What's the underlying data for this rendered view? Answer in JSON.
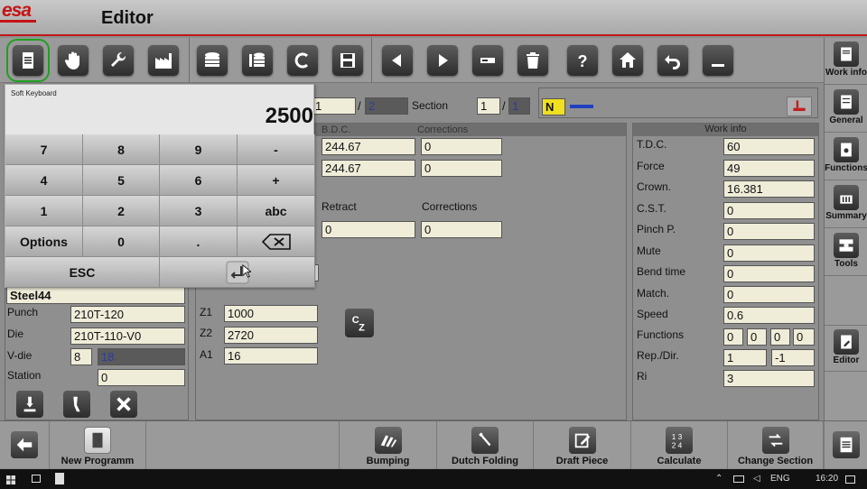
{
  "app": {
    "logo": "esa",
    "title": "Editor"
  },
  "toolbar": {
    "buttons": [
      "document-icon",
      "hand-icon",
      "wrench-icon",
      "factory-icon",
      "database-icon",
      "database-edit-icon",
      "c-icon",
      "save-icon",
      "arrow-left-icon",
      "arrow-right-icon",
      "minus-icon",
      "trash-icon",
      "help-icon",
      "home-icon",
      "undo-icon",
      "minimize-icon"
    ]
  },
  "right_panel": {
    "items": [
      {
        "label": "Work info",
        "icon": "work-info-icon"
      },
      {
        "label": "General",
        "icon": "general-icon"
      },
      {
        "label": "Functions",
        "icon": "functions-icon"
      },
      {
        "label": "Summary",
        "icon": "summary-icon"
      },
      {
        "label": "Tools",
        "icon": "tools-icon"
      },
      {
        "label": "Editor",
        "icon": "editor-icon"
      }
    ]
  },
  "status": {
    "bend_current": "1",
    "bend_total": "2",
    "section_label": "Section",
    "section_current": "1",
    "section_total": "1",
    "mode": "N"
  },
  "bend_panel": {
    "bdc_label": "B.D.C.",
    "corrections_label": "Corrections",
    "bdc_values": [
      "244.67",
      "244.67"
    ],
    "corrections_values": [
      "0",
      "0"
    ],
    "retract_label": "Retract",
    "retract_corrections_label": "Corrections",
    "retract_value": "0",
    "retract_correction_value": "0",
    "z1_label": "Z1",
    "z1": "1000",
    "z2_label": "Z2",
    "z2": "2720",
    "a1_label": "A1",
    "a1": "16"
  },
  "tool_panel": {
    "material": "Steel44",
    "punch_label": "Punch",
    "punch": "210T-120",
    "die_label": "Die",
    "die": "210T-110-V0",
    "vdie_label": "V-die",
    "vdie_a": "8",
    "vdie_b": "18",
    "station_label": "Station",
    "station": "0"
  },
  "work_info": {
    "header": "Work info",
    "rows": [
      {
        "label": "T.D.C.",
        "value": "60"
      },
      {
        "label": "Force",
        "value": "49"
      },
      {
        "label": "Crown.",
        "value": "16.381"
      },
      {
        "label": "C.S.T.",
        "value": "0"
      },
      {
        "label": "Pinch P.",
        "value": "0"
      },
      {
        "label": "Mute",
        "value": "0"
      },
      {
        "label": "Bend time",
        "value": "0"
      },
      {
        "label": "Match.",
        "value": "0"
      },
      {
        "label": "Speed",
        "value": "0.6"
      }
    ],
    "functions_label": "Functions",
    "functions": [
      "0",
      "0",
      "0",
      "0"
    ],
    "repdir_label": "Rep./Dir.",
    "rep": "1",
    "dir": "-1",
    "ri_label": "Ri",
    "ri": "3"
  },
  "keyboard": {
    "title": "Soft Keyboard",
    "value": "2500",
    "keys": [
      [
        "7",
        "8",
        "9",
        "-"
      ],
      [
        "4",
        "5",
        "6",
        "+"
      ],
      [
        "1",
        "2",
        "3",
        "abc"
      ],
      [
        "Options",
        "0",
        ".",
        "⌫"
      ]
    ],
    "esc": "ESC"
  },
  "bottombar": {
    "items": [
      {
        "label": "",
        "icon": "back-arrow-icon"
      },
      {
        "label": "New Programm",
        "icon": "new-document-icon"
      },
      {
        "label": "Bumping",
        "icon": "bumping-icon"
      },
      {
        "label": "Dutch Folding",
        "icon": "dutch-folding-icon"
      },
      {
        "label": "Draft Piece",
        "icon": "draft-piece-icon"
      },
      {
        "label": "Calculate",
        "icon": "calculate-icon"
      },
      {
        "label": "Change Section",
        "icon": "change-section-icon"
      },
      {
        "label": "",
        "icon": "list-icon"
      }
    ]
  },
  "taskbar": {
    "lang": "ENG",
    "time": "16:20"
  }
}
